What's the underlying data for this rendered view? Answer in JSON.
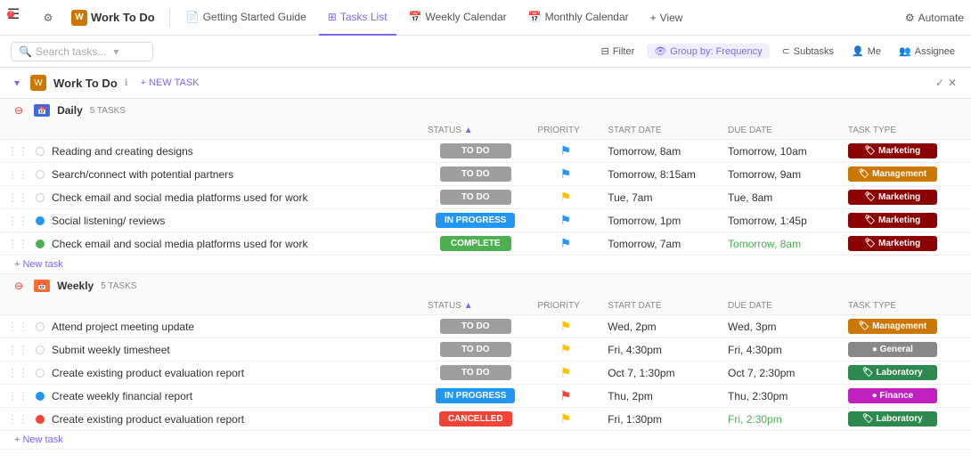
{
  "topnav": {
    "hamburger": "☰",
    "settings": "⚙",
    "workspace": "Work To Do",
    "tabs": [
      {
        "label": "Getting Started Guide",
        "icon": "📄",
        "active": false
      },
      {
        "label": "Tasks List",
        "icon": "⊞",
        "active": true
      },
      {
        "label": "Weekly Calendar",
        "icon": "📅",
        "active": false
      },
      {
        "label": "Monthly Calendar",
        "icon": "📅",
        "active": false
      },
      {
        "label": "View",
        "icon": "+",
        "active": false
      }
    ],
    "automate": "Automate"
  },
  "toolbar": {
    "search_placeholder": "Search tasks...",
    "filter": "Filter",
    "group_by": "Group by: Frequency",
    "subtasks": "Subtasks",
    "me": "Me",
    "assignee": "Assignee"
  },
  "work_header": {
    "title": "Work To Do",
    "new_task": "+ NEW TASK"
  },
  "groups": [
    {
      "id": "daily",
      "label": "Daily",
      "task_count": "5 TASKS",
      "color": "#4169e1",
      "columns": {
        "status": "STATUS",
        "priority": "PRIORITY",
        "start_date": "START DATE",
        "due_date": "DUE DATE",
        "task_type": "TASK TYPE"
      },
      "tasks": [
        {
          "name": "Reading and creating designs",
          "dot": "empty",
          "status": "TO DO",
          "status_class": "todo",
          "priority": "blue",
          "start": "Tomorrow, 8am",
          "due": "Tomorrow, 10am",
          "due_class": "",
          "type": "Marketing",
          "type_class": "marketing"
        },
        {
          "name": "Search/connect with potential partners",
          "dot": "empty",
          "status": "TO DO",
          "status_class": "todo",
          "priority": "blue",
          "start": "Tomorrow, 8:15am",
          "due": "Tomorrow, 9am",
          "due_class": "",
          "type": "Management",
          "type_class": "management"
        },
        {
          "name": "Check email and social media platforms used for work",
          "dot": "empty",
          "status": "TO DO",
          "status_class": "todo",
          "priority": "yellow",
          "start": "Tue, 7am",
          "due": "Tue, 8am",
          "due_class": "",
          "type": "Marketing",
          "type_class": "marketing"
        },
        {
          "name": "Social listening/ reviews",
          "dot": "blue",
          "status": "IN PROGRESS",
          "status_class": "inprogress",
          "priority": "blue",
          "start": "Tomorrow, 1pm",
          "due": "Tomorrow, 1:45p",
          "due_class": "",
          "type": "Marketing",
          "type_class": "marketing"
        },
        {
          "name": "Check email and social media platforms used for work",
          "dot": "green",
          "status": "COMPLETE",
          "status_class": "complete",
          "priority": "blue",
          "start": "Tomorrow, 7am",
          "due": "Tomorrow, 8am",
          "due_class": "highlight",
          "type": "Marketing",
          "type_class": "marketing"
        }
      ]
    },
    {
      "id": "weekly",
      "label": "Weekly",
      "task_count": "5 TASKS",
      "color": "#ff6b35",
      "columns": {
        "status": "STATUS",
        "priority": "PRIORITY",
        "start_date": "START DATE",
        "due_date": "DUE DATE",
        "task_type": "TASK TYPE"
      },
      "tasks": [
        {
          "name": "Attend project meeting update",
          "dot": "empty",
          "status": "TO DO",
          "status_class": "todo",
          "priority": "yellow",
          "start": "Wed, 2pm",
          "due": "Wed, 3pm",
          "due_class": "",
          "type": "Management",
          "type_class": "management"
        },
        {
          "name": "Submit weekly timesheet",
          "dot": "empty",
          "status": "TO DO",
          "status_class": "todo",
          "priority": "yellow",
          "start": "Fri, 4:30pm",
          "due": "Fri, 4:30pm",
          "due_class": "",
          "type": "General",
          "type_class": "general"
        },
        {
          "name": "Create existing product evaluation report",
          "dot": "empty",
          "status": "TO DO",
          "status_class": "todo",
          "priority": "yellow",
          "start": "Oct 7, 1:30pm",
          "due": "Oct 7, 2:30pm",
          "due_class": "",
          "type": "Laboratory",
          "type_class": "laboratory"
        },
        {
          "name": "Create weekly financial report",
          "dot": "blue",
          "status": "IN PROGRESS",
          "status_class": "inprogress",
          "priority": "red",
          "start": "Thu, 2pm",
          "due": "Thu, 2:30pm",
          "due_class": "",
          "type": "Finance",
          "type_class": "finance"
        },
        {
          "name": "Create existing product evaluation report",
          "dot": "red",
          "status": "CANCELLED",
          "status_class": "cancelled",
          "priority": "yellow",
          "start": "Fri, 1:30pm",
          "due": "Fri, 2:30pm",
          "due_class": "highlight",
          "type": "Laboratory",
          "type_class": "laboratory"
        }
      ]
    }
  ]
}
